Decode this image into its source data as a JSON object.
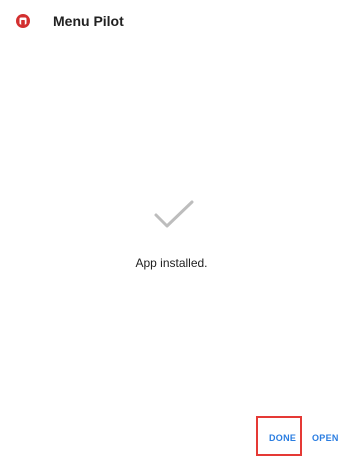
{
  "header": {
    "icon": "app-logo-icon",
    "title": "Menu Pilot"
  },
  "main": {
    "status_icon": "checkmark-icon",
    "status_text": "App installed."
  },
  "actions": {
    "done_label": "DONE",
    "open_label": "OPEN"
  },
  "colors": {
    "accent": "#2a7de1",
    "brand": "#d32f2f",
    "highlight": "#e53935",
    "check": "#bdbdbd"
  }
}
